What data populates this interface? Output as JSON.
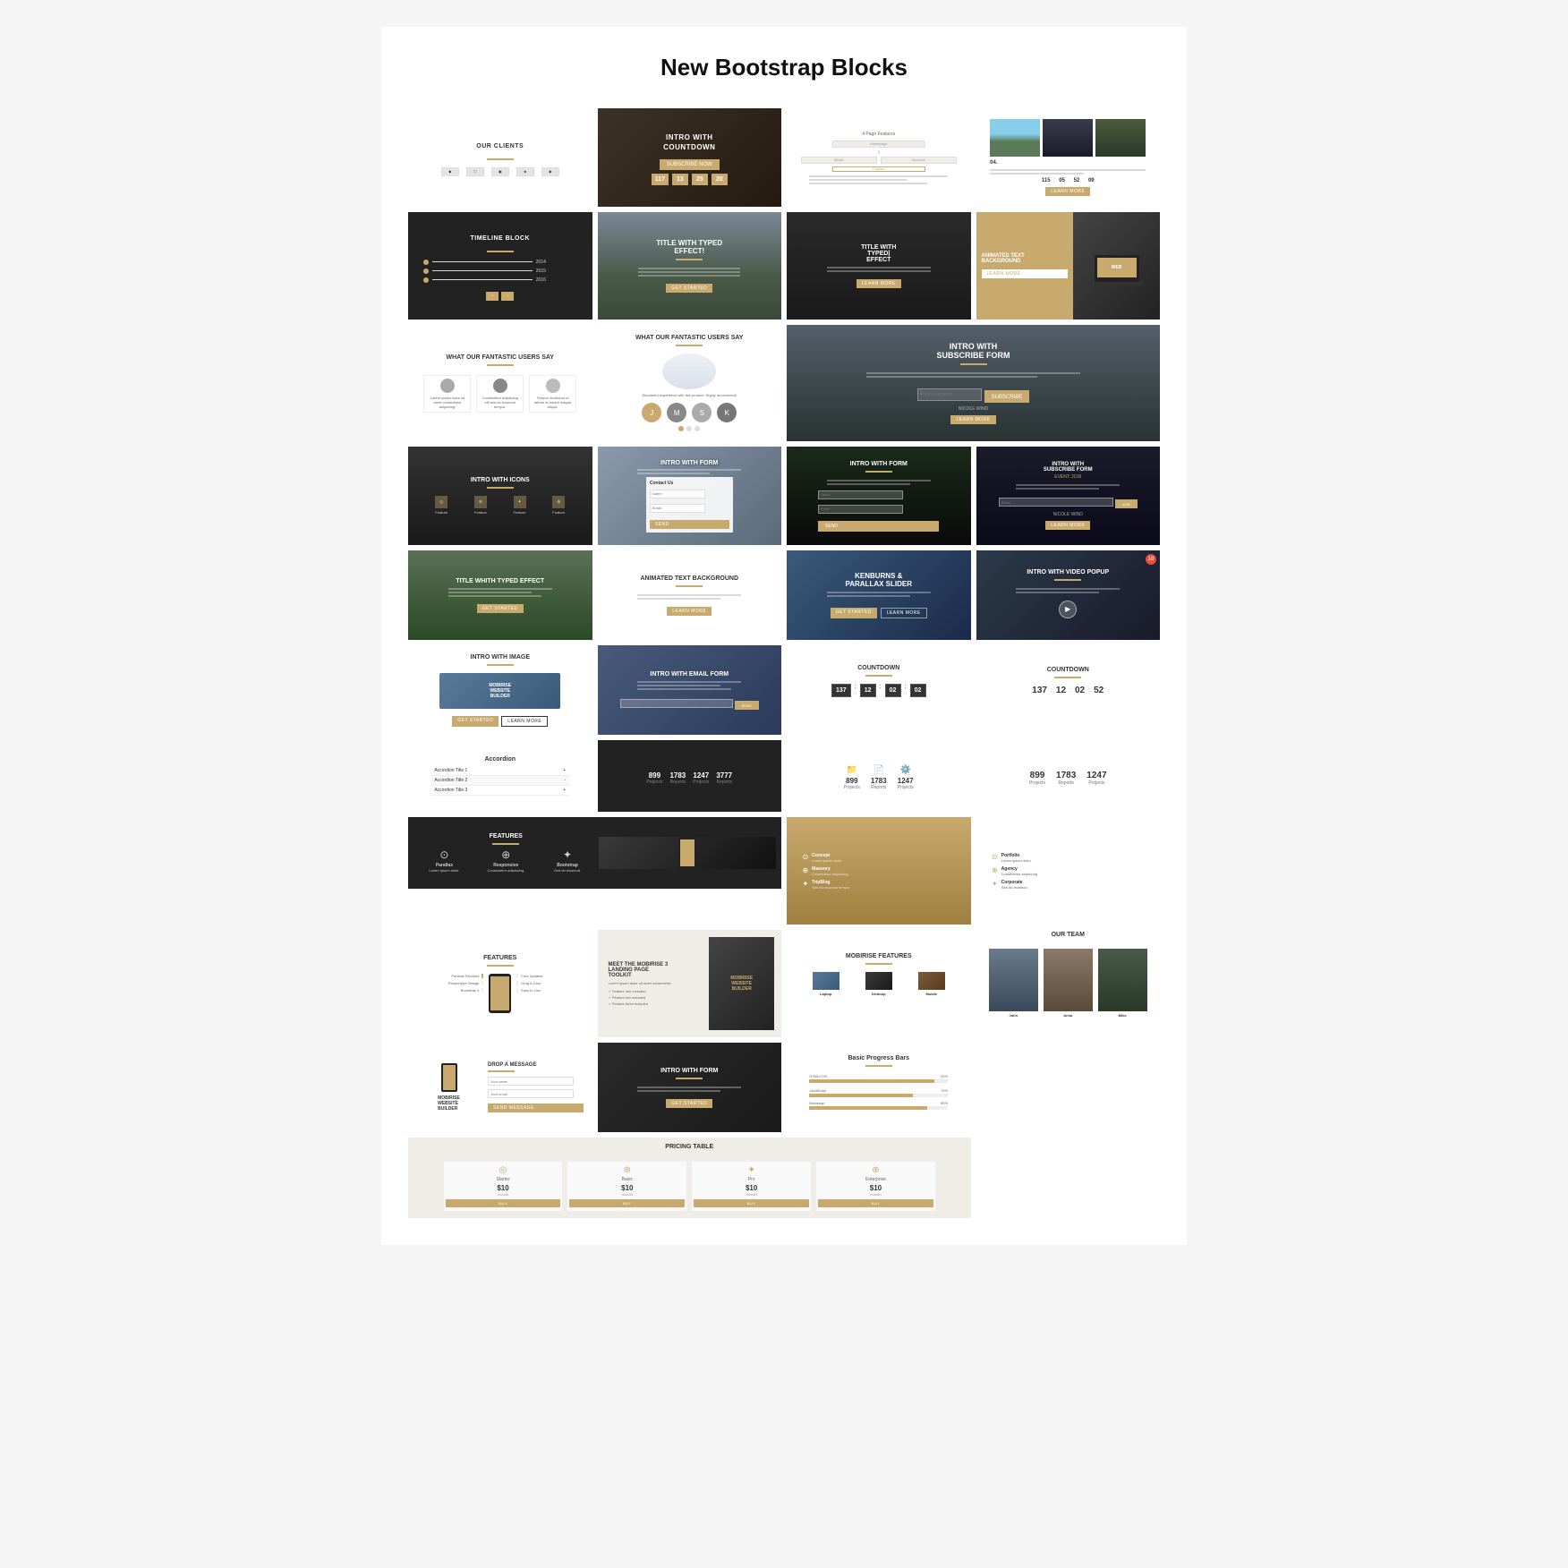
{
  "page": {
    "title": "New Bootstrap Blocks"
  },
  "blocks": [
    {
      "id": "our-clients",
      "label": "OUR CLIENTS",
      "theme": "white",
      "span": 1
    },
    {
      "id": "intro-countdown",
      "label": "INTRO WITH COUNTDOWN",
      "sublabel": "SUBSCRIBE NOW",
      "theme": "dark",
      "span": 1
    },
    {
      "id": "multipage-flowchart",
      "label": "",
      "theme": "white",
      "span": 1
    },
    {
      "id": "photo-grid",
      "label": "",
      "theme": "white",
      "span": 1
    },
    {
      "id": "timeline",
      "label": "TIMELINE BLOCK",
      "theme": "dark",
      "span": 1
    },
    {
      "id": "title-typed",
      "label": "TITLE WITH TYPED EFFECT!",
      "theme": "mountain",
      "span": 1
    },
    {
      "id": "title-typed2",
      "label": "TITLE WITH TYPED EFFECT",
      "theme": "dark",
      "span": 1
    },
    {
      "id": "countdown-timer",
      "label": "",
      "theme": "dark",
      "span": 1
    },
    {
      "id": "animated-text-bg",
      "label": "ANIMATED TEXT BACKGROUND",
      "theme": "warm",
      "span": 1
    },
    {
      "id": "title-typed3",
      "label": "TITLE WHITH TYPED EFFECT",
      "theme": "forest",
      "span": 1
    },
    {
      "id": "animated-text-bg2",
      "label": "ANIMATED TEXT BACKGROUND",
      "theme": "white",
      "span": 1
    },
    {
      "id": "kenburns",
      "label": "KENBURNS & PARALLAX SLIDER",
      "theme": "sky",
      "span": 1
    },
    {
      "id": "users-say",
      "label": "WHAT OUR FANTASTIC USERS SAY",
      "theme": "white",
      "span": 1
    },
    {
      "id": "users-say2",
      "label": "WHAT OUR FANTASTIC USERS SAY",
      "theme": "white",
      "span": 1
    },
    {
      "id": "intro-subscribe",
      "label": "INTRO WITH SUBSCRIBE FORM",
      "theme": "mountain2",
      "span": 2
    },
    {
      "id": "intro-icons",
      "label": "INTRO WITH ICONS",
      "theme": "keyboard",
      "span": 1
    },
    {
      "id": "intro-form1",
      "label": "INTRO WITH FORM",
      "theme": "desk",
      "span": 1
    },
    {
      "id": "intro-form2",
      "label": "INTRO WITH FORM",
      "theme": "dark",
      "span": 1
    },
    {
      "id": "intro-subscribe2",
      "label": "INTRO WITH SUBSCRIBE FORM",
      "theme": "dark2",
      "span": 1
    },
    {
      "id": "intro-video",
      "label": "INTRO WITH VIDEO POPUP",
      "theme": "laptop",
      "span": 1
    },
    {
      "id": "intro-image",
      "label": "INTRO WITH IMAGE",
      "theme": "white",
      "span": 1
    },
    {
      "id": "intro-email",
      "label": "INTRO WITH EMAIL FORM",
      "theme": "sky2",
      "span": 1
    },
    {
      "id": "countdown1",
      "label": "COUNTDOWN",
      "theme": "white",
      "span": 1
    },
    {
      "id": "countdown2",
      "label": "COUNTDOWN",
      "theme": "white",
      "span": 1
    },
    {
      "id": "accordion",
      "label": "Accordion",
      "theme": "white",
      "span": 1
    },
    {
      "id": "stats1",
      "label": "",
      "theme": "white",
      "span": 1
    },
    {
      "id": "stats-icons",
      "label": "",
      "theme": "white",
      "span": 1
    },
    {
      "id": "stats2",
      "label": "",
      "theme": "white",
      "span": 1
    },
    {
      "id": "stats3",
      "label": "",
      "theme": "white",
      "span": 1
    },
    {
      "id": "features1",
      "label": "FEATURES",
      "theme": "dark3",
      "span": 1
    },
    {
      "id": "meet-mobirise",
      "label": "MEET THE MOBIRISE 3 LANDING PAGE TOOLKIT",
      "theme": "white",
      "span": 1
    },
    {
      "id": "col-features1",
      "label": "",
      "theme": "warm2",
      "span": 1
    },
    {
      "id": "col-features2",
      "label": "",
      "theme": "white",
      "span": 1
    },
    {
      "id": "features2",
      "label": "FEATURES",
      "theme": "white",
      "span": 1
    },
    {
      "id": "mobirise-features",
      "label": "MOBIRISE FEATURES",
      "theme": "white",
      "span": 1
    },
    {
      "id": "our-team",
      "label": "OUR TEAM",
      "theme": "white",
      "span": 1
    },
    {
      "id": "drop-message",
      "label": "DROP A MESSAGE",
      "theme": "white",
      "span": 1
    },
    {
      "id": "intro-form3",
      "label": "INTRO WITH FORM",
      "theme": "dark4",
      "span": 1
    },
    {
      "id": "progress-bars",
      "label": "Basic Progress Bars",
      "theme": "white",
      "span": 1
    }
  ],
  "countdown": {
    "days": "117",
    "hours": "13",
    "minutes": "25",
    "seconds": "20"
  },
  "countdown2": {
    "days": "115",
    "hours": "05",
    "minutes": "52",
    "seconds": "09"
  },
  "countdown3": {
    "d1": "137",
    "h1": "12",
    "m1": "02",
    "s1": "02"
  },
  "countdown4": {
    "d": "137",
    "h": "12",
    "m": "02",
    "s": "52"
  },
  "stats": {
    "val1": "899",
    "val2": "1783",
    "val3": "1247",
    "val4": "3777",
    "lbl1": "Projects",
    "lbl2": "Reports",
    "lbl3": "Projects",
    "lbl4": "Reports"
  },
  "pricing": {
    "price1": "$10",
    "price2": "$10",
    "price3": "$10",
    "price4": "$10"
  }
}
